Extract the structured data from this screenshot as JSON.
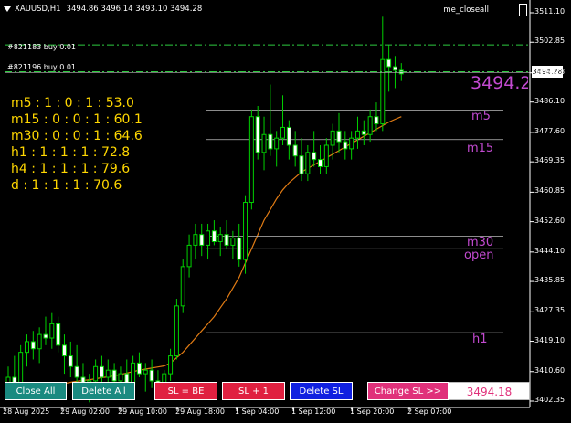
{
  "header": {
    "symbol": "XAUUSD,H1",
    "ohlc": "3494.86 3496.14 3493.10 3494.28"
  },
  "expert_name": "me_closeall",
  "orders": [
    {
      "label": "#821183 buy 0.01",
      "price": 3502.1
    },
    {
      "label": "#821196 buy 0.01",
      "price": 3494.6
    }
  ],
  "stats": [
    "m5 : 1 : 0 : 1 : 53.0",
    "m15 : 0 : 0 : 1 : 60.1",
    "m30 : 0 : 0 : 1 : 64.6",
    "h1 : 1 : 1 : 1 : 72.8",
    "h4 : 1 : 1 : 1 : 79.6",
    "d : 1 : 1 : 1 : 70.6"
  ],
  "levels": [
    {
      "name": "m5",
      "price": 3483.8
    },
    {
      "name": "m15",
      "price": 3475.6
    },
    {
      "name": "m30",
      "price": 3448.5
    },
    {
      "name": "open",
      "price": 3445.0
    },
    {
      "name": "h1",
      "price": 3421.5
    }
  ],
  "big_price": "3494.28",
  "current_price_tag": "3494.28",
  "y_axis": [
    "3511.10",
    "3502.85",
    "3494.28",
    "3486.10",
    "3477.60",
    "3469.35",
    "3460.85",
    "3452.60",
    "3444.10",
    "3435.85",
    "3427.35",
    "3419.10",
    "3410.60",
    "3402.35"
  ],
  "x_axis": [
    "28 Aug 2025",
    "29 Aug 02:00",
    "29 Aug 10:00",
    "29 Aug 18:00",
    "1 Sep 04:00",
    "1 Sep 12:00",
    "1 Sep 20:00",
    "2 Sep 07:00"
  ],
  "buttons": {
    "close_all": "Close All",
    "delete_all": "Delete All",
    "sl_be": "SL = BE",
    "sl_plus": "SL + 1",
    "delete_sl": "Delete SL",
    "change_sl": "Change SL >>",
    "sl_value": "3494.18"
  },
  "colors": {
    "bull": "#00d000",
    "bear": "#ffffff",
    "ma": "#e07b14",
    "level_text": "#c24ad0",
    "stats_text": "#ffd700"
  },
  "candles": [
    [
      3406,
      3412,
      3403,
      3409
    ],
    [
      3409,
      3415,
      3405,
      3406
    ],
    [
      3406,
      3418,
      3405,
      3416
    ],
    [
      3416,
      3421,
      3412,
      3419
    ],
    [
      3419,
      3422,
      3414,
      3417
    ],
    [
      3417,
      3423,
      3413,
      3421
    ],
    [
      3421,
      3426,
      3418,
      3420
    ],
    [
      3420,
      3427,
      3417,
      3424
    ],
    [
      3424,
      3426,
      3416,
      3418
    ],
    [
      3418,
      3421,
      3410,
      3415
    ],
    [
      3415,
      3419,
      3409,
      3412
    ],
    [
      3412,
      3418,
      3407,
      3409
    ],
    [
      3409,
      3413,
      3404,
      3406
    ],
    [
      3406,
      3410,
      3402,
      3408
    ],
    [
      3408,
      3414,
      3406,
      3412
    ],
    [
      3412,
      3415,
      3407,
      3409
    ],
    [
      3409,
      3414,
      3405,
      3411
    ],
    [
      3411,
      3413,
      3406,
      3408
    ],
    [
      3408,
      3412,
      3404,
      3410
    ],
    [
      3410,
      3414,
      3406,
      3407
    ],
    [
      3407,
      3415,
      3404,
      3413
    ],
    [
      3413,
      3416,
      3409,
      3410
    ],
    [
      3410,
      3413,
      3405,
      3411
    ],
    [
      3411,
      3414,
      3406,
      3408
    ],
    [
      3408,
      3411,
      3403,
      3406
    ],
    [
      3406,
      3411,
      3403,
      3410
    ],
    [
      3410,
      3417,
      3408,
      3415
    ],
    [
      3415,
      3431,
      3414,
      3429
    ],
    [
      3429,
      3442,
      3427,
      3440
    ],
    [
      3440,
      3449,
      3437,
      3446
    ],
    [
      3446,
      3452,
      3442,
      3449
    ],
    [
      3449,
      3452,
      3443,
      3446
    ],
    [
      3446,
      3452,
      3442,
      3450
    ],
    [
      3450,
      3453,
      3446,
      3447
    ],
    [
      3447,
      3451,
      3443,
      3449
    ],
    [
      3449,
      3453,
      3445,
      3446
    ],
    [
      3446,
      3450,
      3442,
      3448
    ],
    [
      3448,
      3452,
      3440,
      3442
    ],
    [
      3442,
      3460,
      3438,
      3458
    ],
    [
      3458,
      3484,
      3456,
      3482
    ],
    [
      3482,
      3485,
      3470,
      3472
    ],
    [
      3472,
      3482,
      3467,
      3477
    ],
    [
      3477,
      3491,
      3471,
      3473
    ],
    [
      3473,
      3478,
      3468,
      3476
    ],
    [
      3476,
      3488,
      3474,
      3479
    ],
    [
      3479,
      3481,
      3470,
      3474
    ],
    [
      3474,
      3478,
      3468,
      3471
    ],
    [
      3471,
      3476,
      3464,
      3466
    ],
    [
      3466,
      3474,
      3464,
      3472
    ],
    [
      3472,
      3478,
      3468,
      3470
    ],
    [
      3470,
      3474,
      3466,
      3468
    ],
    [
      3468,
      3476,
      3466,
      3474
    ],
    [
      3474,
      3480,
      3470,
      3478
    ],
    [
      3478,
      3483,
      3472,
      3475
    ],
    [
      3475,
      3478,
      3470,
      3473
    ],
    [
      3473,
      3478,
      3470,
      3476
    ],
    [
      3476,
      3482,
      3473,
      3478
    ],
    [
      3478,
      3481,
      3474,
      3477
    ],
    [
      3477,
      3484,
      3475,
      3482
    ],
    [
      3482,
      3486,
      3478,
      3480
    ],
    [
      3480,
      3510,
      3478,
      3498
    ],
    [
      3498,
      3502,
      3489,
      3496
    ],
    [
      3496,
      3499,
      3490,
      3495
    ],
    [
      3495,
      3497,
      3492,
      3494
    ]
  ],
  "ma": [
    3403,
    3403.5,
    3404,
    3404.5,
    3405,
    3405.5,
    3406,
    3406.5,
    3407,
    3407.3,
    3407.6,
    3407.9,
    3408.1,
    3408.3,
    3408.6,
    3408.9,
    3409.1,
    3409.4,
    3409.8,
    3410.2,
    3410.6,
    3411,
    3411.3,
    3411.6,
    3411.9,
    3412.2,
    3413,
    3414.5,
    3416,
    3418,
    3420,
    3422,
    3424,
    3426,
    3428.5,
    3431,
    3434,
    3437,
    3441,
    3445,
    3449,
    3453,
    3456,
    3459,
    3461.5,
    3463.5,
    3465,
    3466.5,
    3467.5,
    3468.5,
    3469.5,
    3470.5,
    3471.5,
    3472.5,
    3473.5,
    3474.5,
    3475.5,
    3476.5,
    3477.5,
    3478.5,
    3479.5,
    3480.5,
    3481.3,
    3482
  ]
}
